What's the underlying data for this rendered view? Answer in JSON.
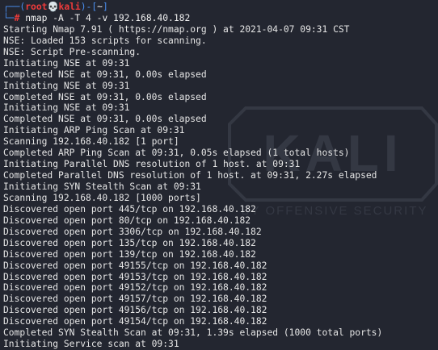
{
  "prompt": {
    "corner_top": "┌──(",
    "user": "root",
    "skull": "💀",
    "host": "kali",
    "path_open": ")-[",
    "path": "~",
    "path_close": "]",
    "corner_bottom": "└─",
    "hash": "#",
    "command": " nmap -A -T 4 -v 192.168.40.182"
  },
  "output": [
    "Starting Nmap 7.91 ( https://nmap.org ) at 2021-04-07 09:31 CST",
    "NSE: Loaded 153 scripts for scanning.",
    "NSE: Script Pre-scanning.",
    "Initiating NSE at 09:31",
    "Completed NSE at 09:31, 0.00s elapsed",
    "Initiating NSE at 09:31",
    "Completed NSE at 09:31, 0.00s elapsed",
    "Initiating NSE at 09:31",
    "Completed NSE at 09:31, 0.00s elapsed",
    "Initiating ARP Ping Scan at 09:31",
    "Scanning 192.168.40.182 [1 port]",
    "Completed ARP Ping Scan at 09:31, 0.05s elapsed (1 total hosts)",
    "Initiating Parallel DNS resolution of 1 host. at 09:31",
    "Completed Parallel DNS resolution of 1 host. at 09:31, 2.27s elapsed",
    "Initiating SYN Stealth Scan at 09:31",
    "Scanning 192.168.40.182 [1000 ports]",
    "Discovered open port 445/tcp on 192.168.40.182",
    "Discovered open port 80/tcp on 192.168.40.182",
    "Discovered open port 3306/tcp on 192.168.40.182",
    "Discovered open port 135/tcp on 192.168.40.182",
    "Discovered open port 139/tcp on 192.168.40.182",
    "Discovered open port 49155/tcp on 192.168.40.182",
    "Discovered open port 49153/tcp on 192.168.40.182",
    "Discovered open port 49152/tcp on 192.168.40.182",
    "Discovered open port 49157/tcp on 192.168.40.182",
    "Discovered open port 49156/tcp on 192.168.40.182",
    "Discovered open port 49154/tcp on 192.168.40.182",
    "Completed SYN Stealth Scan at 09:31, 1.39s elapsed (1000 total ports)",
    "Initiating Service scan at 09:31"
  ],
  "watermark": {
    "logo_text": "KALI",
    "tagline": "BY OFFENSIVE SECURITY"
  },
  "colors": {
    "background": "#232630",
    "text": "#e6e6e6",
    "prompt_frame": "#4a8ff0",
    "prompt_user": "#ee3b3b"
  }
}
